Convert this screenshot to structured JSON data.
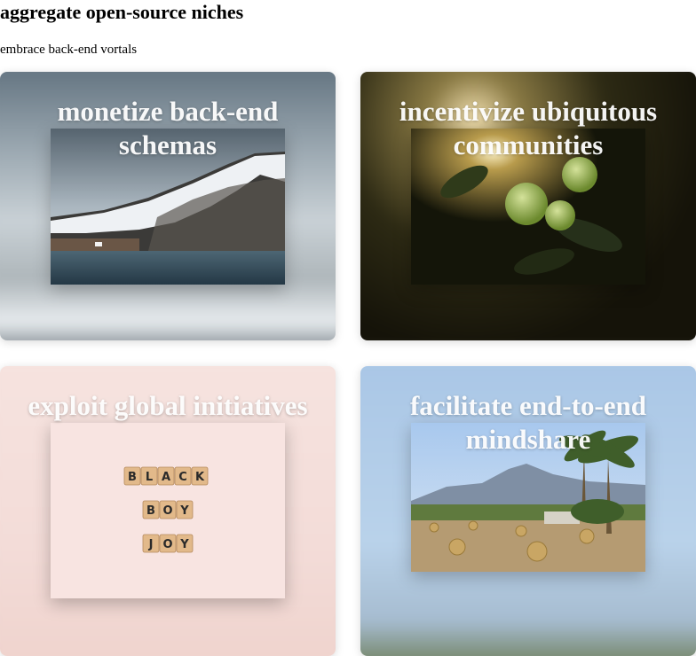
{
  "page": {
    "title": "aggregate open-source niches",
    "subtitle": "embrace back-end vortals"
  },
  "cards": [
    {
      "title": "monetize back-end schemas",
      "image": "snowy-mountain-fjord-photo"
    },
    {
      "title": "incentivize ubiquitous communities",
      "image": "green-apples-tree-photo"
    },
    {
      "title": "exploit global initiatives",
      "image": "scrabble-tiles-photo"
    },
    {
      "title": "facilitate end-to-end mindshare",
      "image": "palm-trees-hay-bales-photo"
    }
  ],
  "tiles": {
    "rows": [
      [
        "B",
        "L",
        "A",
        "C",
        "K"
      ],
      [
        "B",
        "O",
        "Y"
      ],
      [
        "J",
        "O",
        "Y"
      ]
    ]
  }
}
